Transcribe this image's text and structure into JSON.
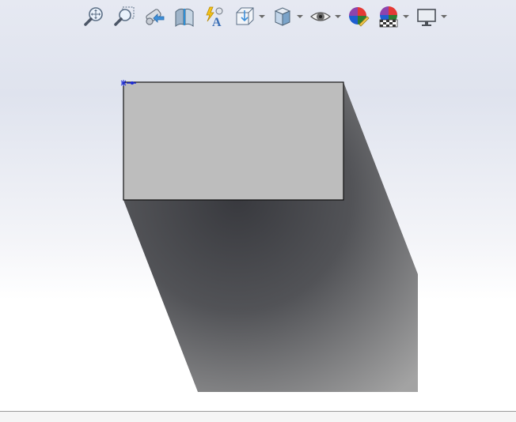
{
  "toolbar": {
    "items": [
      {
        "icon": "zoom-to-fit-icon",
        "dropdown": false
      },
      {
        "icon": "zoom-to-area-icon",
        "dropdown": false
      },
      {
        "icon": "previous-view-icon",
        "dropdown": false
      },
      {
        "icon": "section-view-icon",
        "dropdown": false
      },
      {
        "icon": "dynamic-annotation-views-icon",
        "dropdown": false
      },
      {
        "icon": "view-orientation-icon",
        "dropdown": true
      },
      {
        "icon": "display-style-icon",
        "dropdown": true
      },
      {
        "icon": "hide-show-items-icon",
        "dropdown": true
      },
      {
        "icon": "edit-appearance-icon",
        "dropdown": false
      },
      {
        "icon": "apply-scene-icon",
        "dropdown": true
      },
      {
        "icon": "view-settings-icon",
        "dropdown": true
      }
    ]
  },
  "colors": {
    "face_front": "#bdbdbd",
    "edge": "#111111",
    "shadow_dark": "#3b3c41",
    "shadow_light": "#9a9a9a",
    "origin_marker": "#1d2bd6"
  }
}
